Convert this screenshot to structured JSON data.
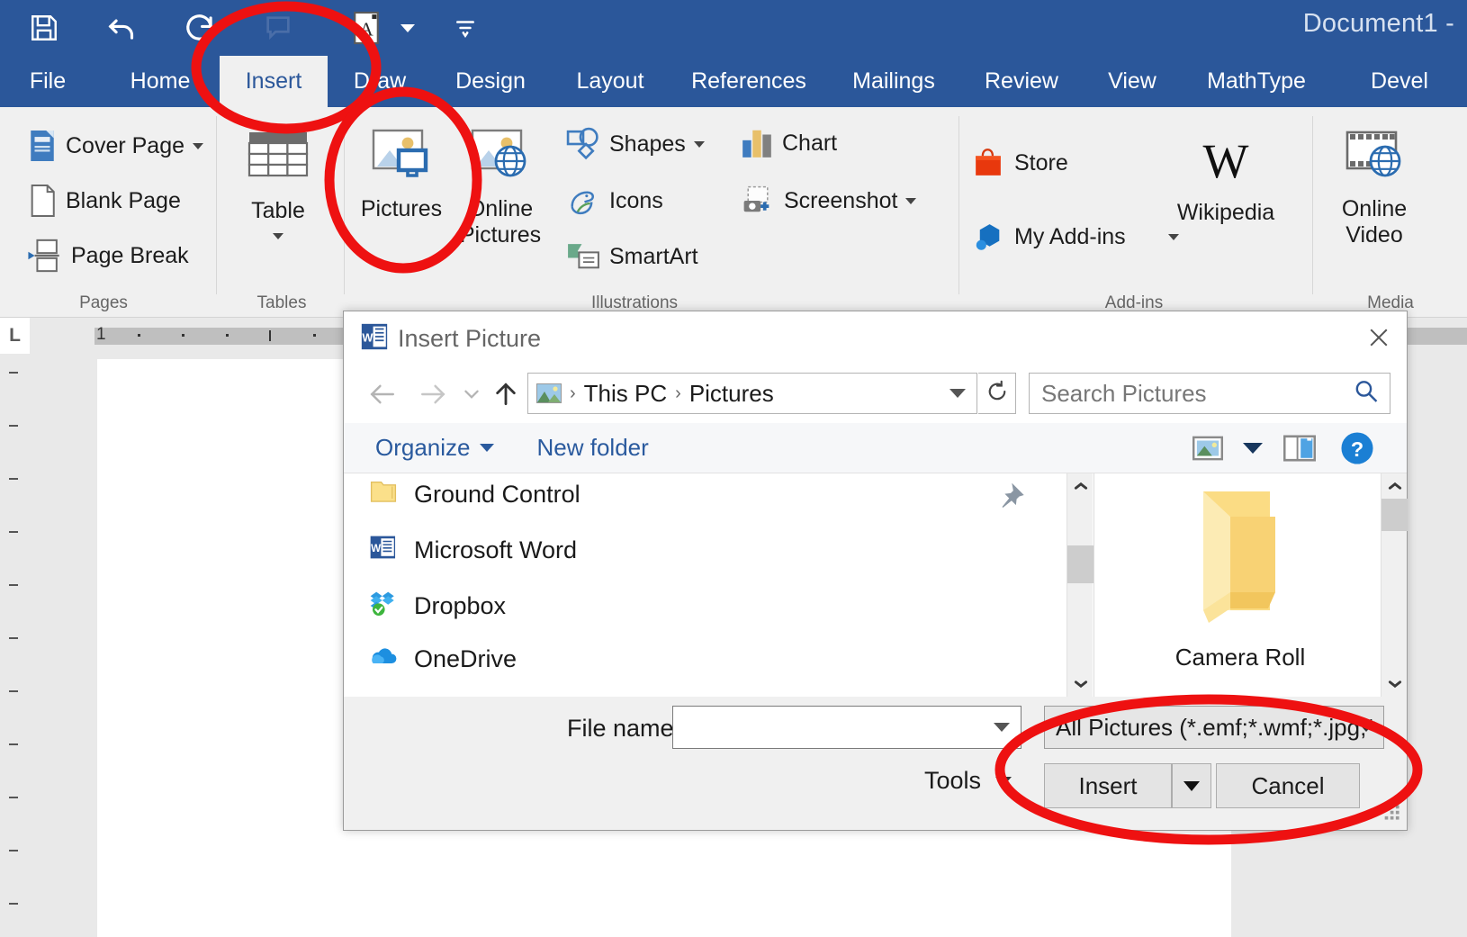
{
  "app": {
    "document_title": "Document1 -",
    "quick_access": [
      {
        "name": "save-icon",
        "label": "Save"
      },
      {
        "name": "undo-icon",
        "label": "Undo"
      },
      {
        "name": "redo-icon",
        "label": "Repeat"
      },
      {
        "name": "comment-icon",
        "label": "Comment"
      },
      {
        "name": "print-preview-icon",
        "label": "Print Preview"
      },
      {
        "name": "customize-qat-icon",
        "label": "Customize Quick Access Toolbar"
      }
    ]
  },
  "ribbon": {
    "tabs": [
      {
        "label": "File",
        "active": false
      },
      {
        "label": "Home",
        "active": false
      },
      {
        "label": "Insert",
        "active": true
      },
      {
        "label": "Draw",
        "active": false
      },
      {
        "label": "Design",
        "active": false
      },
      {
        "label": "Layout",
        "active": false
      },
      {
        "label": "References",
        "active": false
      },
      {
        "label": "Mailings",
        "active": false
      },
      {
        "label": "Review",
        "active": false
      },
      {
        "label": "View",
        "active": false
      },
      {
        "label": "MathType",
        "active": false
      },
      {
        "label": "Devel",
        "active": false
      }
    ],
    "groups": [
      {
        "name": "pages",
        "label": "Pages"
      },
      {
        "name": "tables",
        "label": "Tables"
      },
      {
        "name": "illustrations",
        "label": "Illustrations"
      },
      {
        "name": "addins",
        "label": "Add-ins"
      },
      {
        "name": "media",
        "label": "Media"
      }
    ],
    "pages": {
      "cover_page": "Cover Page",
      "blank_page": "Blank Page",
      "page_break": "Page Break"
    },
    "tables": {
      "table": "Table"
    },
    "illustrations": {
      "pictures": "Pictures",
      "online_pictures_line1": "Online",
      "online_pictures_line2": "Pictures",
      "shapes": "Shapes",
      "icons": "Icons",
      "smartart": "SmartArt",
      "chart": "Chart",
      "screenshot": "Screenshot"
    },
    "addins": {
      "store": "Store",
      "my_addins": "My Add-ins",
      "wikipedia": "Wikipedia"
    },
    "media": {
      "online_video_line1": "Online",
      "online_video_line2": "Video"
    }
  },
  "document": {
    "ruler_number": "1"
  },
  "dialog": {
    "title": "Insert Picture",
    "close_label": "Close",
    "breadcrumb": {
      "items": [
        "This PC",
        "Pictures"
      ],
      "separator": "›"
    },
    "search": {
      "placeholder": "Search Pictures"
    },
    "commands": {
      "organize": "Organize",
      "new_folder": "New folder"
    },
    "nav_items": [
      {
        "label": "Ground Control",
        "icon": "folder-icon"
      },
      {
        "label": "Microsoft Word",
        "icon": "word-icon"
      },
      {
        "label": "Dropbox",
        "icon": "dropbox-icon"
      },
      {
        "label": "OneDrive",
        "icon": "onedrive-icon"
      }
    ],
    "files": [
      {
        "label": "Camera Roll",
        "icon": "folder-icon"
      }
    ],
    "footer": {
      "file_name_label": "File name:",
      "file_name_value": "",
      "filter_value": "All Pictures (*.emf;*.wmf;*.jpg;*",
      "tools_label": "Tools",
      "insert_label": "Insert",
      "cancel_label": "Cancel"
    }
  },
  "annotations": {
    "color": "#ee1111",
    "shapes": [
      {
        "name": "insert-tab-highlight"
      },
      {
        "name": "pictures-button-highlight"
      },
      {
        "name": "insert-cancel-buttons-highlight"
      }
    ]
  }
}
